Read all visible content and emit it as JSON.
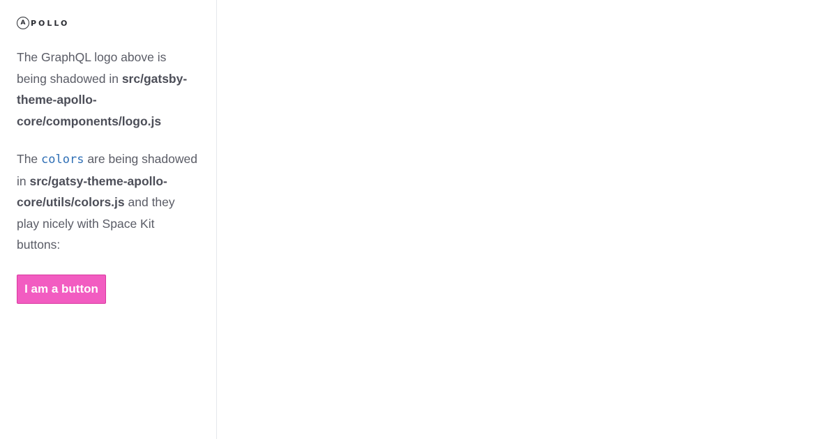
{
  "logo": {
    "mark": "A",
    "text": "POLLO"
  },
  "paragraph1": {
    "text_before": "The GraphQL logo above is being shadowed in ",
    "path": "src/gatsby-theme-apollo-core/components/logo.js"
  },
  "paragraph2": {
    "text_before": "The ",
    "code": "colors",
    "text_middle": " are being shadowed in ",
    "path": "src/gatsy-theme-apollo-core/utils/colors.js",
    "text_after": " and they play nicely with Space Kit buttons:"
  },
  "button": {
    "label": "I am a button"
  },
  "colors": {
    "button_bg": "#f25cc1",
    "code_text": "#2f6fb5",
    "body_text": "#5a5c66",
    "divider": "#e5e7ec"
  }
}
